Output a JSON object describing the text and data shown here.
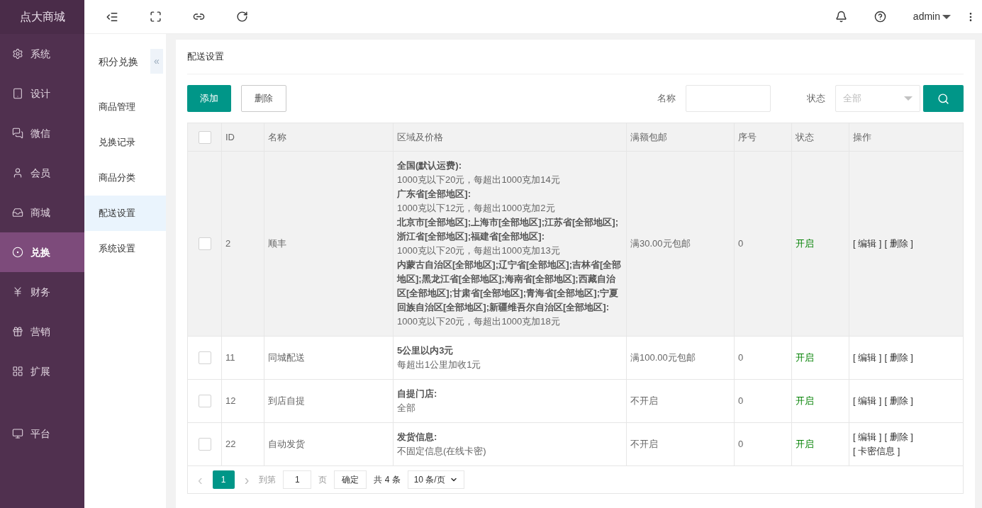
{
  "brand": "点大商城",
  "nav": [
    {
      "label": "系统",
      "selected": false
    },
    {
      "label": "设计",
      "selected": false
    },
    {
      "label": "微信",
      "selected": false
    },
    {
      "label": "会员",
      "selected": false
    },
    {
      "label": "商城",
      "selected": false
    },
    {
      "label": "兑换",
      "selected": true
    },
    {
      "label": "财务",
      "selected": false
    },
    {
      "label": "营销",
      "selected": false
    },
    {
      "label": "扩展",
      "selected": false
    },
    {
      "label": "平台",
      "selected": false
    }
  ],
  "user": {
    "name": "admin"
  },
  "submenu": {
    "title": "积分兑换",
    "collapse": "«",
    "items": [
      {
        "label": "商品管理",
        "selected": false
      },
      {
        "label": "兑换记录",
        "selected": false
      },
      {
        "label": "商品分类",
        "selected": false
      },
      {
        "label": "配送设置",
        "selected": true
      },
      {
        "label": "系统设置",
        "selected": false
      }
    ]
  },
  "page_title": "配送设置",
  "toolbar": {
    "add": "添加",
    "delete": "删除",
    "name_label": "名称",
    "status_label": "状态",
    "status_placeholder": "全部"
  },
  "table": {
    "all_checked": false,
    "columns": [
      "ID",
      "名称",
      "区域及价格",
      "满额包邮",
      "序号",
      "状态",
      "操作"
    ],
    "rows": [
      {
        "checked": false,
        "highlighted": true,
        "id": "2",
        "name": "顺丰",
        "region": [
          {
            "kind": "area",
            "text": "全国(默认运费):"
          },
          {
            "kind": "price",
            "text": "1000克以下20元，每超出1000克加14元"
          },
          {
            "kind": "area",
            "text": "广东省[全部地区]:"
          },
          {
            "kind": "price",
            "text": "1000克以下12元，每超出1000克加2元"
          },
          {
            "kind": "area",
            "text": "北京市[全部地区];上海市[全部地区];江苏省[全部地区];浙江省[全部地区];福建省[全部地区]:"
          },
          {
            "kind": "price",
            "text": "1000克以下20元，每超出1000克加13元"
          },
          {
            "kind": "area",
            "text": "内蒙古自治区[全部地区];辽宁省[全部地区];吉林省[全部地区];黑龙江省[全部地区];海南省[全部地区];西藏自治区[全部地区];甘肃省[全部地区];青海省[全部地区];宁夏回族自治区[全部地区];新疆维吾尔自治区[全部地区]:"
          },
          {
            "kind": "price",
            "text": "1000克以下20元，每超出1000克加18元"
          }
        ],
        "free_shipping": "满30.00元包邮",
        "order": "0",
        "status": "开启",
        "on": true,
        "actions": [
          "[ 编辑 ]",
          "[ 删除 ]"
        ]
      },
      {
        "checked": false,
        "highlighted": false,
        "id": "11",
        "name": "同城配送",
        "region": [
          {
            "kind": "area",
            "text": "5公里以内3元"
          },
          {
            "kind": "price",
            "text": "每超出1公里加收1元"
          }
        ],
        "free_shipping": "满100.00元包邮",
        "order": "0",
        "status": "开启",
        "on": true,
        "actions": [
          "[ 编辑 ]",
          "[ 删除 ]"
        ]
      },
      {
        "checked": false,
        "highlighted": false,
        "id": "12",
        "name": "到店自提",
        "region": [
          {
            "kind": "area",
            "text": "自提门店:"
          },
          {
            "kind": "price",
            "text": "全部"
          }
        ],
        "free_shipping": "不开启",
        "order": "0",
        "status": "开启",
        "on": true,
        "actions": [
          "[ 编辑 ]",
          "[ 删除 ]"
        ]
      },
      {
        "checked": false,
        "highlighted": false,
        "id": "22",
        "name": "自动发货",
        "region": [
          {
            "kind": "area",
            "text": "发货信息:"
          },
          {
            "kind": "price",
            "text": "不固定信息(在线卡密)"
          }
        ],
        "free_shipping": "不开启",
        "order": "0",
        "status": "开启",
        "on": true,
        "actions": [
          "[ 编辑 ]",
          "[ 删除 ]",
          "[ 卡密信息 ]"
        ]
      }
    ]
  },
  "pagination": {
    "prev": "‹",
    "next": "›",
    "pages": [
      {
        "label": "1",
        "selected": true
      }
    ],
    "goto_label": "到第",
    "goto_value": "1",
    "page_unit": "页",
    "confirm": "确定",
    "total": "共 4 条",
    "page_size": "10 条/页"
  }
}
